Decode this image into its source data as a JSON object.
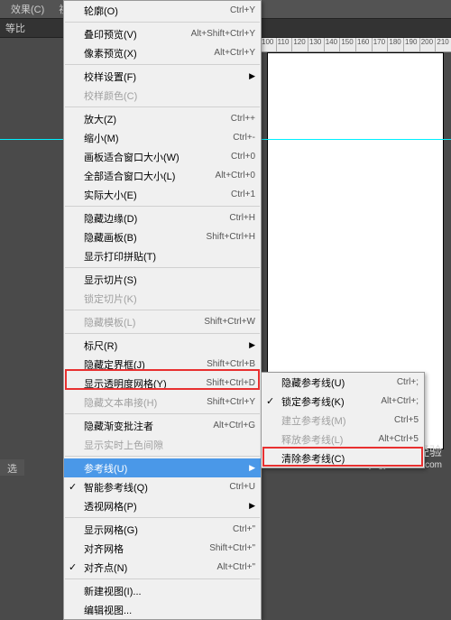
{
  "topbar": {
    "items": [
      "效果(C)",
      "视图(V)"
    ]
  },
  "toolbar": {
    "label": "等比"
  },
  "ruler": {
    "ticks": [
      "100",
      "110",
      "120",
      "130",
      "140",
      "150",
      "160",
      "170",
      "180",
      "190",
      "200",
      "210"
    ]
  },
  "menu": {
    "items": [
      {
        "label": "轮廓(O)",
        "shortcut": "Ctrl+Y"
      },
      {
        "sep": true
      },
      {
        "label": "叠印预览(V)",
        "shortcut": "Alt+Shift+Ctrl+Y"
      },
      {
        "label": "像素预览(X)",
        "shortcut": "Alt+Ctrl+Y"
      },
      {
        "sep": true
      },
      {
        "label": "校样设置(F)",
        "arrow": true
      },
      {
        "label": "校样颜色(C)",
        "disabled": true
      },
      {
        "sep": true
      },
      {
        "label": "放大(Z)",
        "shortcut": "Ctrl++"
      },
      {
        "label": "缩小(M)",
        "shortcut": "Ctrl+-"
      },
      {
        "label": "画板适合窗口大小(W)",
        "shortcut": "Ctrl+0"
      },
      {
        "label": "全部适合窗口大小(L)",
        "shortcut": "Alt+Ctrl+0"
      },
      {
        "label": "实际大小(E)",
        "shortcut": "Ctrl+1"
      },
      {
        "sep": true
      },
      {
        "label": "隐藏边缘(D)",
        "shortcut": "Ctrl+H"
      },
      {
        "label": "隐藏画板(B)",
        "shortcut": "Shift+Ctrl+H"
      },
      {
        "label": "显示打印拼贴(T)"
      },
      {
        "sep": true
      },
      {
        "label": "显示切片(S)"
      },
      {
        "label": "锁定切片(K)",
        "disabled": true
      },
      {
        "sep": true
      },
      {
        "label": "隐藏模板(L)",
        "shortcut": "Shift+Ctrl+W",
        "disabled": true
      },
      {
        "sep": true
      },
      {
        "label": "标尺(R)",
        "arrow": true
      },
      {
        "label": "隐藏定界框(J)",
        "shortcut": "Shift+Ctrl+B"
      },
      {
        "label": "显示透明度网格(Y)",
        "shortcut": "Shift+Ctrl+D"
      },
      {
        "label": "隐藏文本串接(H)",
        "shortcut": "Shift+Ctrl+Y",
        "disabled": true
      },
      {
        "sep": true
      },
      {
        "label": "隐藏渐变批注者",
        "shortcut": "Alt+Ctrl+G"
      },
      {
        "label": "显示实时上色间隙",
        "disabled": true
      },
      {
        "sep": true
      },
      {
        "label": "参考线(U)",
        "arrow": true,
        "highlighted": true
      },
      {
        "label": "智能参考线(Q)",
        "shortcut": "Ctrl+U",
        "checked": true
      },
      {
        "label": "透视网格(P)",
        "arrow": true
      },
      {
        "sep": true
      },
      {
        "label": "显示网格(G)",
        "shortcut": "Ctrl+\""
      },
      {
        "label": "对齐网格",
        "shortcut": "Shift+Ctrl+\""
      },
      {
        "label": "对齐点(N)",
        "shortcut": "Alt+Ctrl+\"",
        "checked": true
      },
      {
        "sep": true
      },
      {
        "label": "新建视图(I)..."
      },
      {
        "label": "编辑视图..."
      }
    ]
  },
  "submenu": {
    "items": [
      {
        "label": "隐藏参考线(U)",
        "shortcut": "Ctrl+;"
      },
      {
        "label": "锁定参考线(K)",
        "shortcut": "Alt+Ctrl+;",
        "checked": true
      },
      {
        "label": "建立参考线(M)",
        "shortcut": "Ctrl+5",
        "disabled": true
      },
      {
        "label": "释放参考线(L)",
        "shortcut": "Alt+Ctrl+5",
        "disabled": true
      },
      {
        "label": "清除参考线(C)"
      }
    ]
  },
  "watermark": {
    "brand": "Baidu 经验",
    "url": "jingyan.baidu.com"
  },
  "statusbar": {
    "text": "选"
  }
}
